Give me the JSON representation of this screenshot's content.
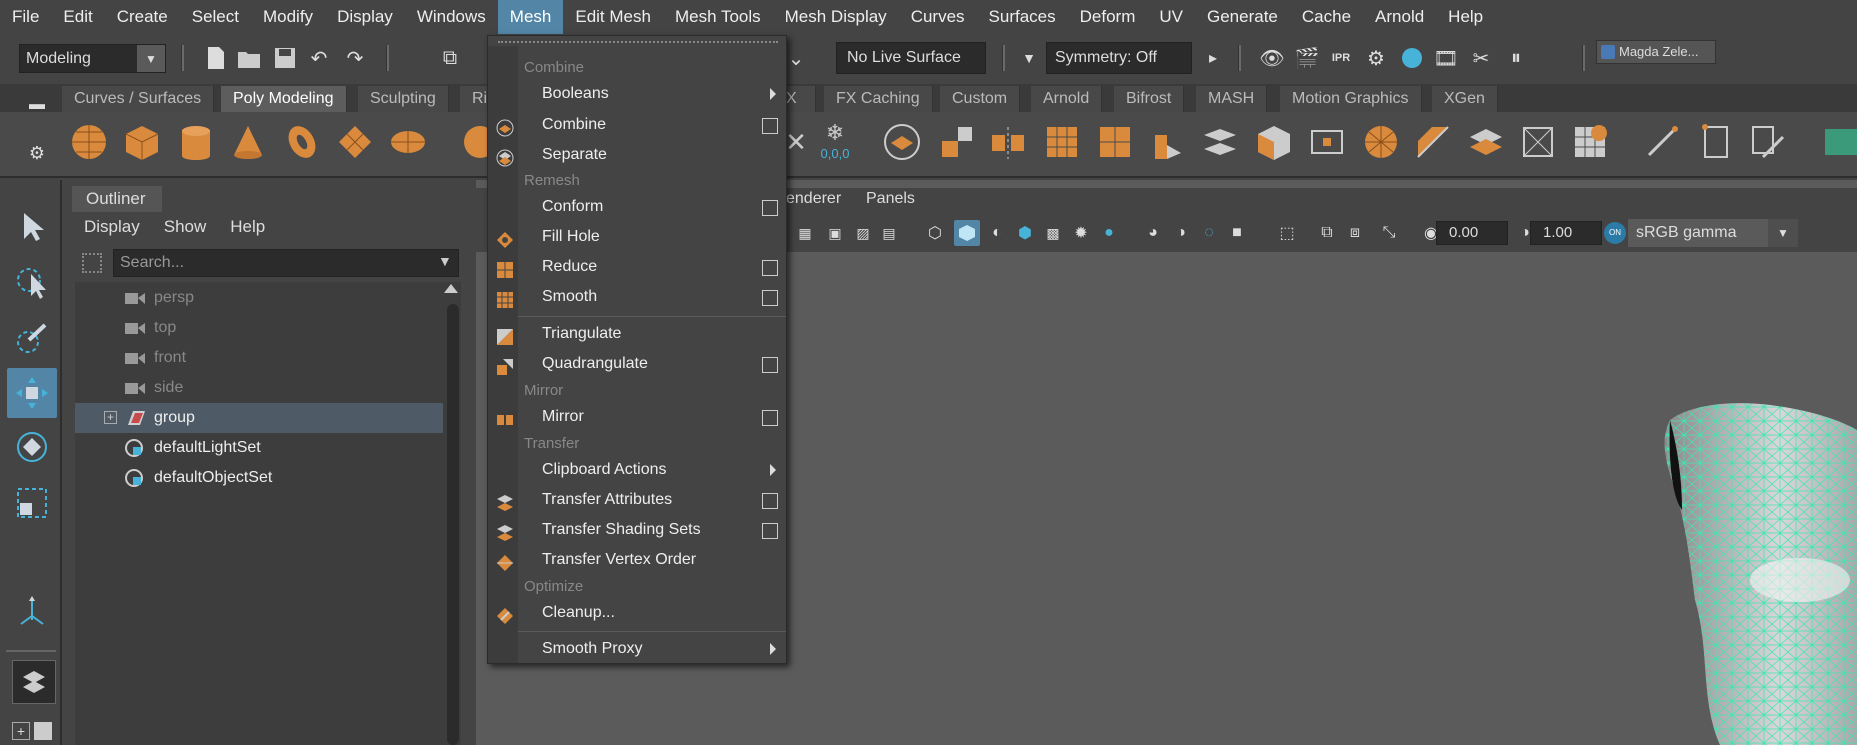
{
  "menubar": {
    "items": [
      "File",
      "Edit",
      "Create",
      "Select",
      "Modify",
      "Display",
      "Windows",
      "Mesh",
      "Edit Mesh",
      "Mesh Tools",
      "Mesh Display",
      "Curves",
      "Surfaces",
      "Deform",
      "UV",
      "Generate",
      "Cache",
      "Arnold",
      "Help"
    ],
    "active": "Mesh"
  },
  "status": {
    "workspace": "Modeling",
    "live_surface": "No Live Surface",
    "symmetry": "Symmetry: Off",
    "user": "Magda Zele..."
  },
  "shelf": {
    "tabs": [
      "Curves / Surfaces",
      "Poly Modeling",
      "Sculpting",
      "Ri",
      "X",
      "FX Caching",
      "Custom",
      "Arnold",
      "Bifrost",
      "MASH",
      "Motion Graphics",
      "XGen"
    ],
    "active": "Poly Modeling",
    "readout": "0,0,0"
  },
  "outliner": {
    "title": "Outliner",
    "menu": [
      "Display",
      "Show",
      "Help"
    ],
    "search_placeholder": "Search...",
    "items": [
      {
        "label": "persp",
        "dim": true
      },
      {
        "label": "top",
        "dim": true
      },
      {
        "label": "front",
        "dim": true
      },
      {
        "label": "side",
        "dim": true
      },
      {
        "label": "group",
        "dim": false,
        "selected": true
      },
      {
        "label": "defaultLightSet",
        "dim": false
      },
      {
        "label": "defaultObjectSet",
        "dim": false
      }
    ]
  },
  "viewport": {
    "menu": [
      "enderer",
      "Panels"
    ],
    "exposure": "0.00",
    "gamma_value": "1.00",
    "colorspace": "sRGB gamma",
    "on_label": "ON"
  },
  "mesh_menu": {
    "sections": {
      "combine": "Combine",
      "remesh": "Remesh",
      "mirror": "Mirror",
      "transfer": "Transfer",
      "optimize": "Optimize"
    },
    "items": {
      "booleans": "Booleans",
      "combine": "Combine",
      "separate": "Separate",
      "conform": "Conform",
      "fill_hole": "Fill Hole",
      "reduce": "Reduce",
      "smooth": "Smooth",
      "triangulate": "Triangulate",
      "quadrangulate": "Quadrangulate",
      "mirror": "Mirror",
      "clipboard_actions": "Clipboard Actions",
      "transfer_attributes": "Transfer Attributes",
      "transfer_shading_sets": "Transfer Shading Sets",
      "transfer_vertex_order": "Transfer Vertex Order",
      "cleanup": "Cleanup...",
      "smooth_proxy": "Smooth Proxy"
    }
  },
  "colors": {
    "accent": "#5285a6",
    "icon_orange": "#d98a3d",
    "mesh_wire": "#3ee6b4"
  }
}
